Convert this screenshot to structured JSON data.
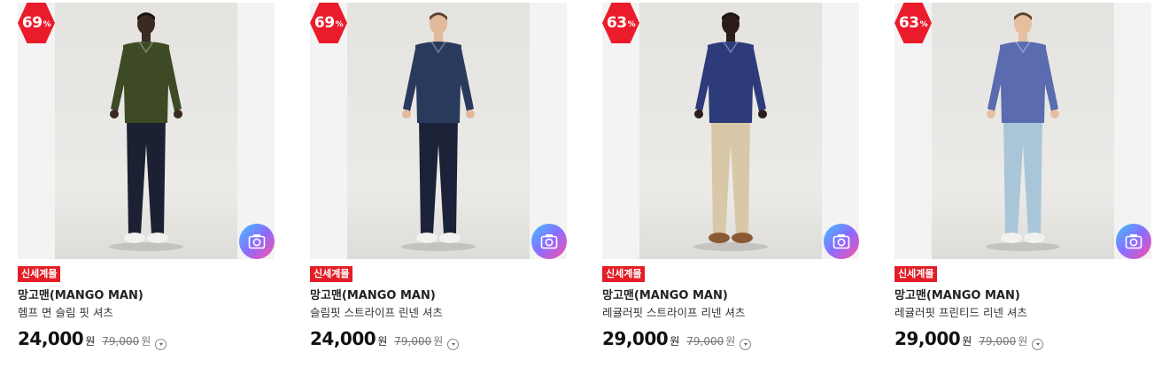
{
  "products": [
    {
      "discount": "69",
      "discount_unit": "%",
      "badge": "신세계몰",
      "brand": "망고맨(MANGO MAN)",
      "title": "헴프 면 슬림 핏 셔츠",
      "price": "24,000",
      "currency": "원",
      "original_price": "79,000",
      "original_currency": "원",
      "image_icon": "camera-search-icon",
      "colors": {
        "shirt": "#3d4a25",
        "pants": "#1c2033",
        "shoes": "#f1f1ef"
      }
    },
    {
      "discount": "69",
      "discount_unit": "%",
      "badge": "신세계몰",
      "brand": "망고맨(MANGO MAN)",
      "title": "슬림핏 스트라이프 린넨 셔츠",
      "price": "24,000",
      "currency": "원",
      "original_price": "79,000",
      "original_currency": "원",
      "image_icon": "camera-search-icon",
      "colors": {
        "shirt": "#2a3a5c",
        "pants": "#1c2238",
        "shoes": "#f1f1ef"
      }
    },
    {
      "discount": "63",
      "discount_unit": "%",
      "badge": "신세계몰",
      "brand": "망고맨(MANGO MAN)",
      "title": "레귤러핏 스트라이프 리넨 셔츠",
      "price": "29,000",
      "currency": "원",
      "original_price": "79,000",
      "original_currency": "원",
      "image_icon": "camera-search-icon",
      "colors": {
        "shirt": "#2d3b7a",
        "pants": "#d8c8a8",
        "shoes": "#8a5a35"
      }
    },
    {
      "discount": "63",
      "discount_unit": "%",
      "badge": "신세계몰",
      "brand": "망고맨(MANGO MAN)",
      "title": "레귤러핏 프린티드 리넨 셔츠",
      "price": "29,000",
      "currency": "원",
      "original_price": "79,000",
      "original_currency": "원",
      "image_icon": "camera-search-icon",
      "colors": {
        "shirt": "#5a6bb0",
        "pants": "#a9c6d9",
        "shoes": "#f1f1ef"
      }
    }
  ]
}
